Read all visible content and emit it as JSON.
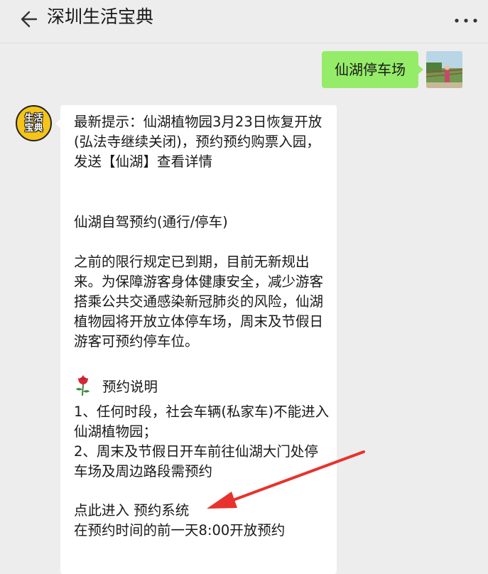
{
  "header": {
    "title": "深圳生活宝典",
    "back_icon": "back-arrow-icon",
    "more_icon": "more-dots-icon"
  },
  "user_message": {
    "text": "仙湖停车场",
    "bubble_color": "#95ec69"
  },
  "bot_avatar": {
    "line1": "生活",
    "line2": "宝典",
    "color": "#f4c419"
  },
  "bot_message": {
    "tip": "最新提示：仙湖植物园3月23日恢复开放(弘法寺继续关闭)，预约预约购票入园，发送【仙湖】查看详情",
    "heading": "仙湖自驾预约(通行/停车)",
    "intro": "之前的限行规定已到期，目前无新规出来。为保障游客身体健康安全，减少游客搭乘公共交通感染新冠肺炎的风险，仙湖植物园将开放立体停车场，周末及节假日游客可预约停车位。",
    "section_icon": "rose-icon",
    "section_title": "预约说明",
    "rule1": "1、任何时段，社会车辆(私家车)不能进入仙湖植物园；",
    "rule2": "2、周末及节假日开车前往仙湖大门处停车场及周边路段需预约",
    "link_label": "点此进入 预约系统",
    "link_color": "#3c8fd6",
    "footer": "在预约时间的前一天8:00开放预约"
  },
  "annotation": {
    "arrow_icon": "red-arrow-icon",
    "color": "#e8322d"
  }
}
